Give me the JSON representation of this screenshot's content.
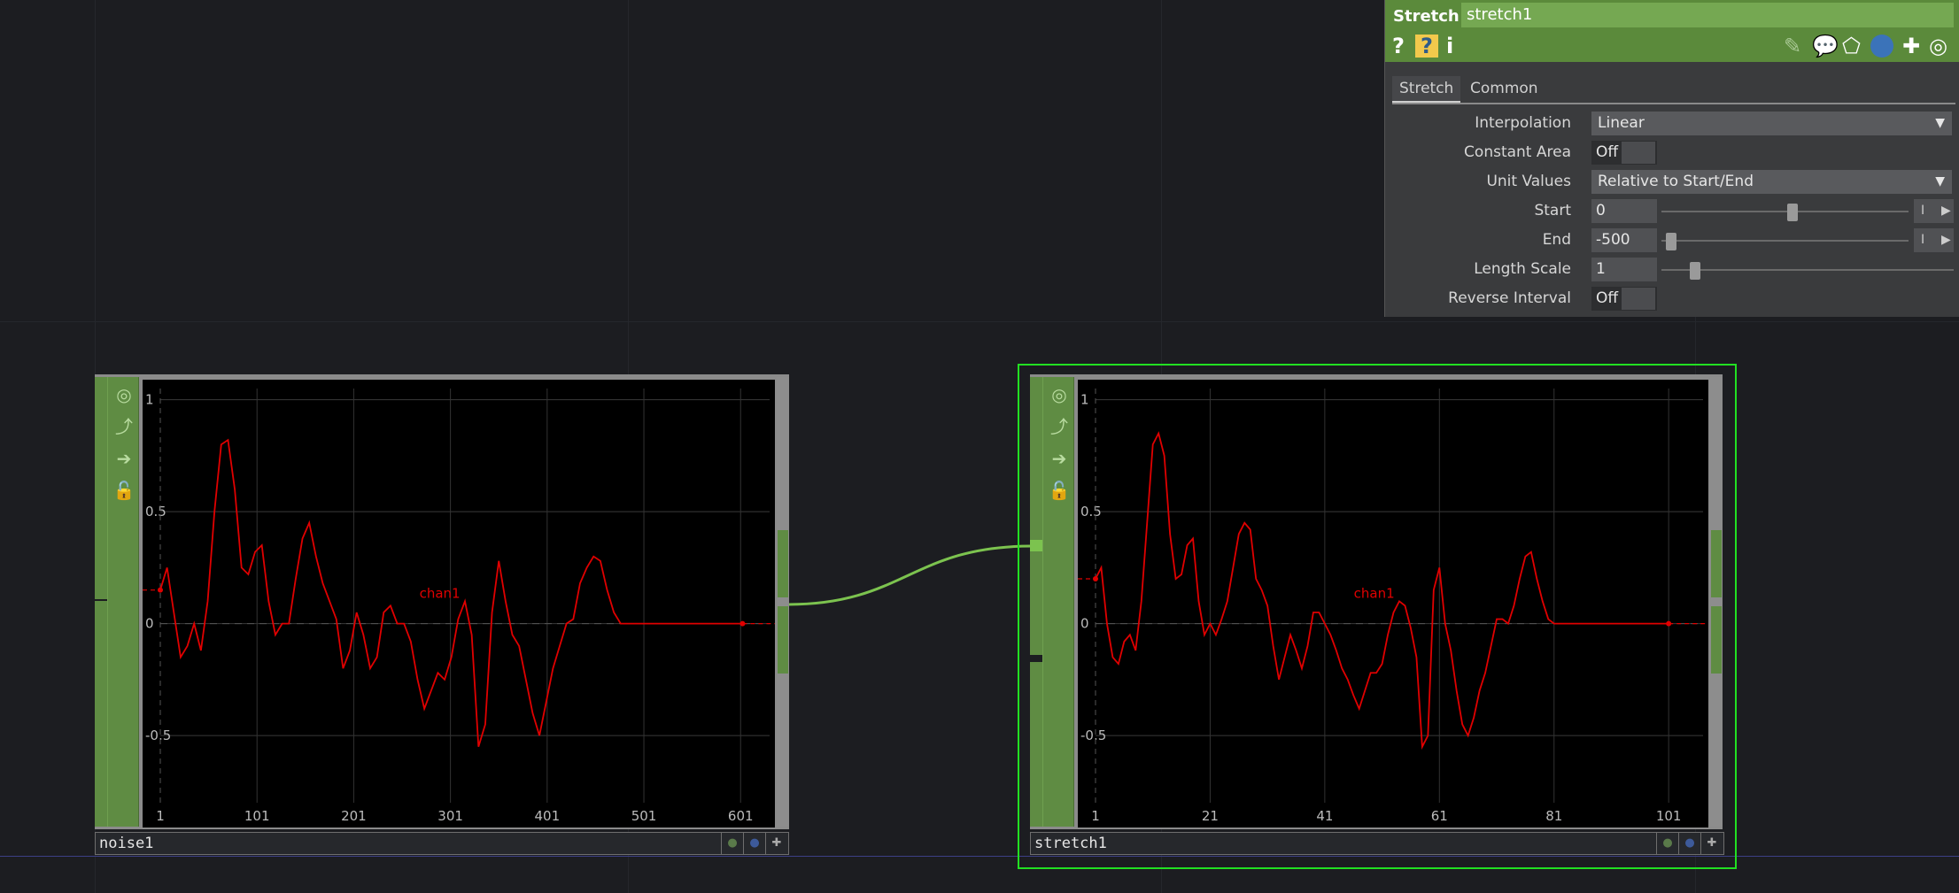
{
  "panel": {
    "op_type": "Stretch",
    "op_name": "stretch1",
    "header_icons": {
      "help": "?",
      "python_help": "?",
      "info": "i"
    },
    "tabs": [
      "Stretch",
      "Common"
    ],
    "params": {
      "interpolation": {
        "label": "Interpolation",
        "value": "Linear"
      },
      "constant_area": {
        "label": "Constant Area",
        "value": "Off"
      },
      "unit_values": {
        "label": "Unit Values",
        "value": "Relative to Start/End"
      },
      "start": {
        "label": "Start",
        "value": "0",
        "slider": 0.53
      },
      "end": {
        "label": "End",
        "value": "-500",
        "slider": 0.02
      },
      "length_scale": {
        "label": "Length Scale",
        "value": "1",
        "slider": 0.1
      },
      "reverse_interval": {
        "label": "Reverse Interval",
        "value": "Off"
      }
    },
    "mode_label": "I"
  },
  "nodes": {
    "noise1": {
      "name": "noise1",
      "channel": "chan1"
    },
    "stretch1": {
      "name": "stretch1",
      "channel": "chan1"
    }
  },
  "chart_data": [
    {
      "type": "line",
      "x_ticks": [
        "1",
        "101",
        "201",
        "301",
        "401",
        "501",
        "601"
      ],
      "y_ticks": [
        "1",
        "0.5",
        "0",
        "-0.5"
      ],
      "xlim": [
        1,
        631
      ],
      "ylim": [
        -0.8,
        1.05
      ],
      "series": [
        {
          "name": "chan1",
          "color": "#e00000",
          "x": [
            1,
            8,
            15,
            22,
            29,
            36,
            43,
            50,
            57,
            64,
            71,
            78,
            85,
            92,
            99,
            106,
            113,
            120,
            127,
            134,
            141,
            148,
            155,
            162,
            169,
            176,
            183,
            190,
            197,
            204,
            211,
            218,
            225,
            232,
            239,
            246,
            253,
            260,
            267,
            274,
            281,
            288,
            295,
            302,
            309,
            316,
            323,
            330,
            337,
            344,
            351,
            358,
            365,
            372,
            379,
            386,
            393,
            400,
            407,
            414,
            421,
            428,
            435,
            442,
            449,
            456,
            463,
            470,
            477,
            484,
            491,
            498,
            505,
            512,
            519,
            526,
            533,
            540,
            547,
            554,
            561,
            568,
            575,
            582,
            589,
            596,
            603
          ],
          "y": [
            0.15,
            0.25,
            0.05,
            -0.15,
            -0.1,
            0.0,
            -0.12,
            0.1,
            0.5,
            0.8,
            0.82,
            0.6,
            0.25,
            0.22,
            0.32,
            0.35,
            0.1,
            -0.05,
            0.0,
            0.0,
            0.2,
            0.38,
            0.45,
            0.3,
            0.18,
            0.1,
            0.02,
            -0.2,
            -0.12,
            0.05,
            -0.05,
            -0.2,
            -0.15,
            0.05,
            0.08,
            0.0,
            0.0,
            -0.08,
            -0.25,
            -0.38,
            -0.3,
            -0.22,
            -0.25,
            -0.15,
            0.02,
            0.1,
            -0.05,
            -0.55,
            -0.45,
            0.05,
            0.28,
            0.1,
            -0.05,
            -0.1,
            -0.25,
            -0.4,
            -0.5,
            -0.35,
            -0.2,
            -0.1,
            0.0,
            0.02,
            0.18,
            0.25,
            0.3,
            0.28,
            0.15,
            0.05,
            0.0,
            0.0,
            0.0,
            0.0,
            0.0,
            0.0,
            0.0,
            0.0,
            0.0,
            0.0,
            0.0,
            0.0,
            0.0,
            0.0,
            0.0,
            0.0,
            0.0,
            0.0,
            0.0
          ]
        }
      ]
    },
    {
      "type": "line",
      "x_ticks": [
        "1",
        "21",
        "41",
        "61",
        "81",
        "101"
      ],
      "y_ticks": [
        "1",
        "0.5",
        "0",
        "-0.5"
      ],
      "xlim": [
        1,
        107
      ],
      "ylim": [
        -0.8,
        1.05
      ],
      "series": [
        {
          "name": "chan1",
          "color": "#e00000",
          "x": [
            1,
            2,
            3,
            4,
            5,
            6,
            7,
            8,
            9,
            10,
            11,
            12,
            13,
            14,
            15,
            16,
            17,
            18,
            19,
            20,
            21,
            22,
            23,
            24,
            25,
            26,
            27,
            28,
            29,
            30,
            31,
            32,
            33,
            34,
            35,
            36,
            37,
            38,
            39,
            40,
            41,
            42,
            43,
            44,
            45,
            46,
            47,
            48,
            49,
            50,
            51,
            52,
            53,
            54,
            55,
            56,
            57,
            58,
            59,
            60,
            61,
            62,
            63,
            64,
            65,
            66,
            67,
            68,
            69,
            70,
            71,
            72,
            73,
            74,
            75,
            76,
            77,
            78,
            79,
            80,
            81,
            82,
            83,
            84,
            85,
            86,
            87,
            88,
            89,
            90,
            91,
            92,
            93,
            94,
            95,
            96,
            97,
            98,
            99,
            100,
            101
          ],
          "y": [
            0.2,
            0.25,
            0.0,
            -0.15,
            -0.18,
            -0.08,
            -0.05,
            -0.12,
            0.1,
            0.45,
            0.8,
            0.85,
            0.75,
            0.4,
            0.2,
            0.22,
            0.35,
            0.38,
            0.1,
            -0.05,
            0.0,
            -0.05,
            0.02,
            0.1,
            0.25,
            0.4,
            0.45,
            0.42,
            0.2,
            0.15,
            0.08,
            -0.1,
            -0.25,
            -0.15,
            -0.05,
            -0.12,
            -0.2,
            -0.1,
            0.05,
            0.05,
            0.0,
            -0.05,
            -0.12,
            -0.2,
            -0.25,
            -0.32,
            -0.38,
            -0.3,
            -0.22,
            -0.22,
            -0.18,
            -0.05,
            0.05,
            0.1,
            0.08,
            -0.02,
            -0.15,
            -0.55,
            -0.5,
            0.15,
            0.25,
            0.0,
            -0.12,
            -0.3,
            -0.45,
            -0.5,
            -0.42,
            -0.3,
            -0.22,
            -0.1,
            0.02,
            0.02,
            0.0,
            0.08,
            0.2,
            0.3,
            0.32,
            0.2,
            0.1,
            0.02,
            0.0,
            0.0,
            0.0,
            0.0,
            0.0,
            0.0,
            0.0,
            0.0,
            0.0,
            0.0,
            0.0,
            0.0,
            0.0,
            0.0,
            0.0,
            0.0,
            0.0,
            0.0,
            0.0,
            0.0,
            0.0
          ]
        }
      ]
    }
  ]
}
